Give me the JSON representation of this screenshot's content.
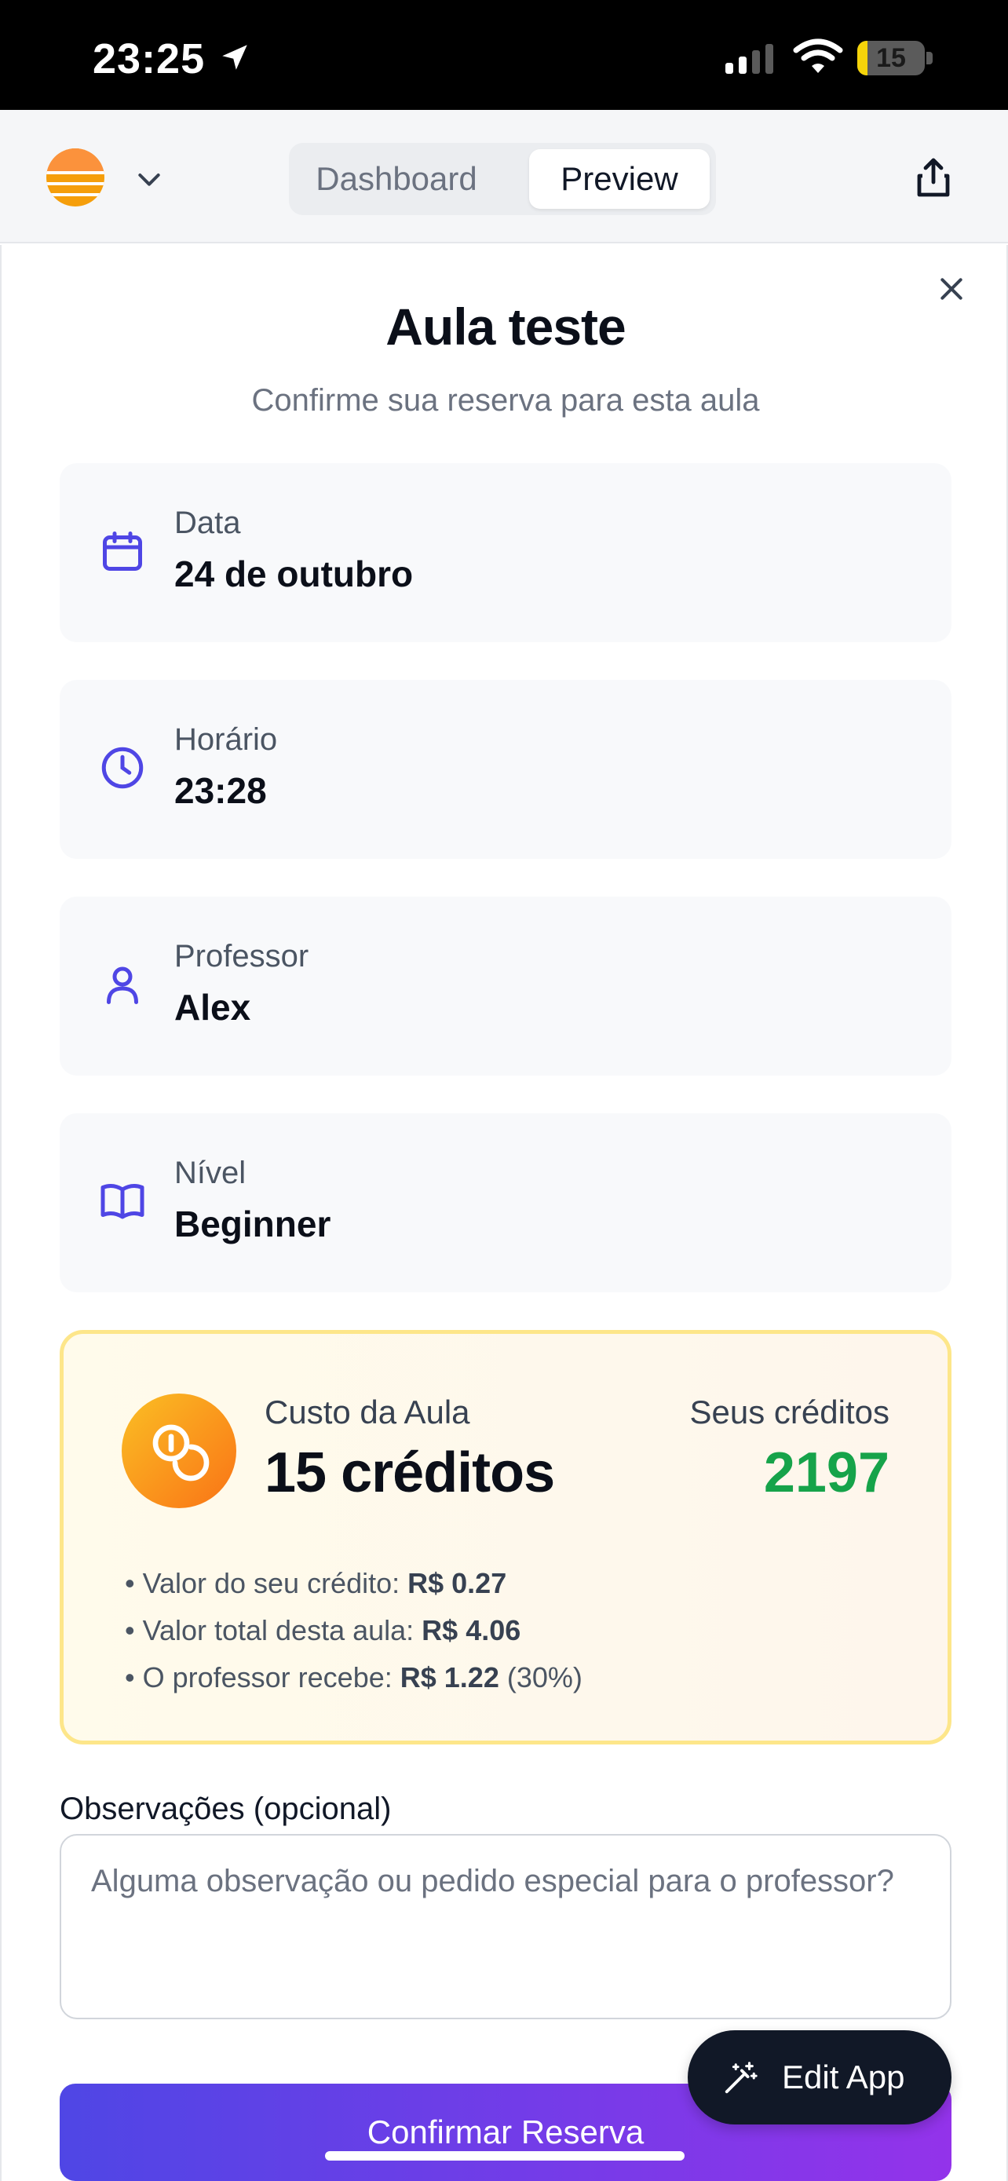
{
  "status_bar": {
    "time": "23:25",
    "battery_level": "15",
    "battery_fraction": 0.15
  },
  "header": {
    "tabs": [
      "Dashboard",
      "Preview"
    ],
    "selected_tab": "Preview"
  },
  "booking": {
    "title": "Aula teste",
    "subtitle": "Confirme sua reserva para esta aula",
    "fields": [
      {
        "label": "Data",
        "value": "24 de outubro",
        "icon": "calendar-icon"
      },
      {
        "label": "Horário",
        "value": "23:28",
        "icon": "clock-icon"
      },
      {
        "label": "Professor",
        "value": "Alex",
        "icon": "user-icon"
      },
      {
        "label": "Nível",
        "value": "Beginner",
        "icon": "book-open-icon"
      }
    ]
  },
  "credits": {
    "cost_label": "Custo da Aula",
    "cost_value": "15 créditos",
    "balance_label": "Seus créditos",
    "balance_value": "2197",
    "bullets": [
      {
        "prefix": "• Valor do seu crédito: ",
        "strong": "R$ 0.27",
        "suffix": ""
      },
      {
        "prefix": "• Valor total desta aula: ",
        "strong": "R$ 4.06",
        "suffix": ""
      },
      {
        "prefix": "• O professor recebe: ",
        "strong": "R$ 1.22",
        "suffix": " (30%)"
      }
    ],
    "colors": {
      "balance": "#16a34a",
      "border": "#fde68a"
    }
  },
  "notes": {
    "label": "Observações (opcional)",
    "placeholder": "Alguma observação ou pedido especial para o professor?",
    "value": ""
  },
  "actions": {
    "confirm_label": "Confirmar Reserva",
    "edit_app_label": "Edit App"
  },
  "colors": {
    "accent_start": "#4f46e5",
    "accent_end": "#9333ea",
    "icon": "#4f46e5"
  }
}
